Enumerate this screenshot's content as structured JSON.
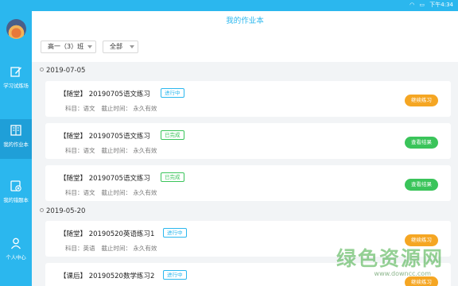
{
  "status_bar": {
    "time": "下午4:34"
  },
  "header": {
    "title": "我的作业本"
  },
  "sidebar": {
    "items": [
      {
        "label": "学习试炼场",
        "icon": "pencil-icon"
      },
      {
        "label": "我的作业本",
        "icon": "book-icon"
      },
      {
        "label": "我的错题本",
        "icon": "error-book-icon"
      },
      {
        "label": "个人中心",
        "icon": "user-icon"
      }
    ]
  },
  "filters": {
    "class_select": "高一（3）班",
    "status_select": "全部"
  },
  "groups": [
    {
      "date": "2019-07-05",
      "cards": [
        {
          "title": "【随堂】 20190705语文练习",
          "status": "进行中",
          "subject": "科目：语文",
          "deadline": "截止时间：  永久有效",
          "action": "继续练习"
        },
        {
          "title": "【随堂】 20190705语文练习",
          "status": "已完成",
          "subject": "科目：语文",
          "deadline": "截止时间：  永久有效",
          "action": "查看结果"
        },
        {
          "title": "【随堂】 20190705语文练习",
          "status": "已完成",
          "subject": "科目：语文",
          "deadline": "截止时间：  永久有效",
          "action": "查看结果"
        }
      ]
    },
    {
      "date": "2019-05-20",
      "cards": [
        {
          "title": "【随堂】 20190520英语练习1",
          "status": "进行中",
          "subject": "科目：英语",
          "deadline": "截止时间：  永久有效",
          "action": "继续练习"
        },
        {
          "title": "【课后】 20190520数学练习2",
          "status": "进行中",
          "action": "继续练习"
        }
      ]
    }
  ],
  "watermark": {
    "text": "绿色资源网",
    "url": "www.downcc.com"
  },
  "colors": {
    "accent": "#2bb7ee",
    "orange": "#f5a623",
    "green": "#3ac45a"
  }
}
